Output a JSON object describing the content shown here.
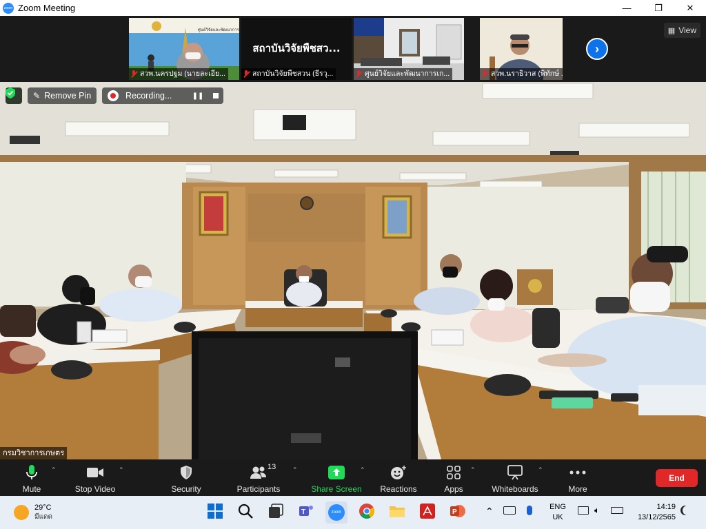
{
  "window": {
    "title": "Zoom Meeting",
    "logo_text": "zoom",
    "controls": {
      "minimize": "—",
      "maximize": "❐",
      "close": "✕"
    }
  },
  "thumbnails": [
    {
      "name": "สวพ.นครปฐม (นายละเอีย...",
      "muted": true,
      "banner": "ศูนย์วิจัยและพัฒนาการเกษตรนครปฐม"
    },
    {
      "name": "สถาบันวิจัยพืชสวน (ธีรวุ...",
      "muted": true,
      "display_text": "สถาบันวิจัยพืชสว..."
    },
    {
      "name": "ศูนย์วิจัยและพัฒนาการเก...",
      "muted": true
    },
    {
      "name": "สวพ.นราธิวาส (พิทักษ์ ...",
      "muted": true
    }
  ],
  "view_button": {
    "label": "View",
    "icon": "grid-icon"
  },
  "next_page_button": {
    "icon": "chevron-right-icon"
  },
  "main_video": {
    "speaker_label": "กรมวิชาการเกษตร",
    "remove_pin_label": "Remove Pin",
    "recording_label": "Recording...",
    "security_badge_icon": "shield-check-icon"
  },
  "toolbar": {
    "mute": {
      "label": "Mute",
      "icon": "microphone-icon"
    },
    "video": {
      "label": "Stop Video",
      "icon": "video-camera-icon"
    },
    "security": {
      "label": "Security",
      "icon": "shield-icon"
    },
    "participants": {
      "label": "Participants",
      "count": "13",
      "icon": "people-icon"
    },
    "share": {
      "label": "Share Screen",
      "icon": "share-arrow-icon"
    },
    "reactions": {
      "label": "Reactions",
      "icon": "smiley-icon"
    },
    "apps": {
      "label": "Apps",
      "icon": "apps-icon"
    },
    "whiteboards": {
      "label": "Whiteboards",
      "icon": "whiteboard-icon"
    },
    "more": {
      "label": "More",
      "icon": "more-dots-icon"
    },
    "end": {
      "label": "End"
    }
  },
  "taskbar": {
    "weather_temp": "29°C",
    "weather_desc": "มีแดด",
    "lang_line1": "ENG",
    "lang_line2": "UK",
    "time": "14:19",
    "date": "13/12/2565"
  },
  "colors": {
    "accent_blue": "#0e72ed",
    "share_green": "#23d959",
    "end_red": "#e02828",
    "toolbar_bg": "#1a1a1a"
  }
}
